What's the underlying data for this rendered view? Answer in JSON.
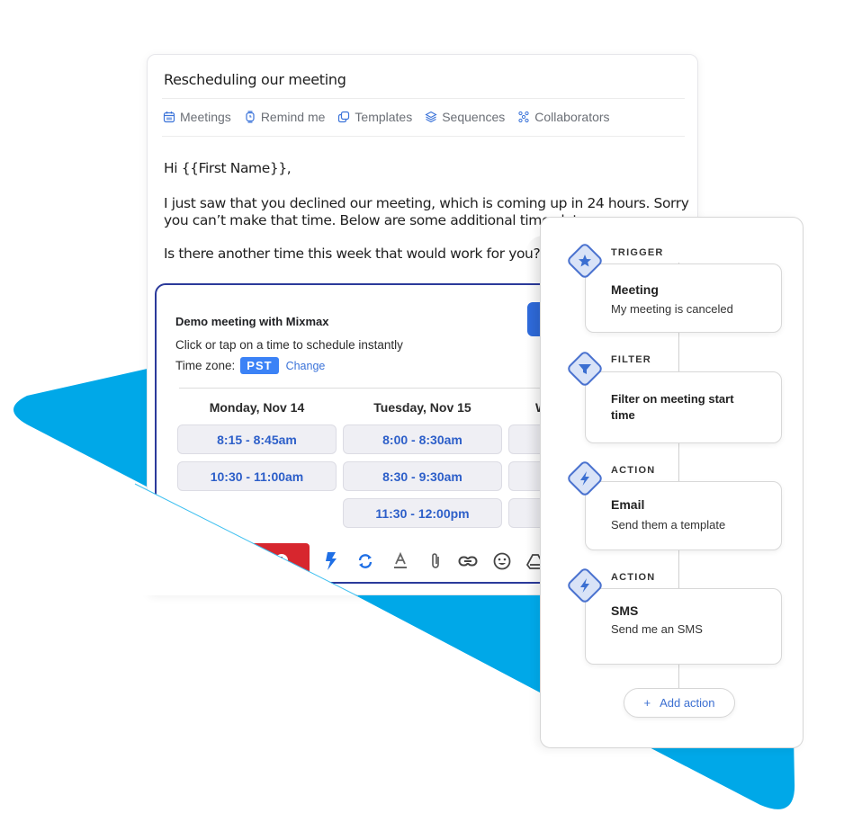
{
  "colors": {
    "brand_blue": "#00a8e8",
    "accent_blue": "#3b73d9",
    "meeting_border": "#2b3a9b",
    "send_red": "#d7262e",
    "diamond_fill": "#d9e3f7",
    "diamond_stroke": "#4a72cf"
  },
  "email": {
    "subject": "Rescheduling our meeting",
    "toolbar": [
      {
        "icon": "calendar-icon",
        "label": "Meetings"
      },
      {
        "icon": "watch-icon",
        "label": "Remind me"
      },
      {
        "icon": "templates-icon",
        "label": "Templates"
      },
      {
        "icon": "layers-icon",
        "label": "Sequences"
      },
      {
        "icon": "collaborators-icon",
        "label": "Collaborators"
      }
    ],
    "greeting": "Hi {{First Name}},",
    "paragraph_line1": "I just saw that you declined our meeting, which is coming up in 24 hours. Sorry",
    "paragraph_line2": "you can’t make that time. Below are some additional time slots",
    "question": "Is there another time this week that would work for you?"
  },
  "meeting": {
    "title": "Demo meeting with Mixmax",
    "instructions": "Click or tap on a time to schedule instantly",
    "timezone_label": "Time zone:",
    "timezone": "PST",
    "change_link": "Change",
    "days": [
      {
        "label": "Monday, Nov 14",
        "slots": [
          "8:15 - 8:45am",
          "10:30 - 11:00am"
        ]
      },
      {
        "label": "Tuesday, Nov 15",
        "slots": [
          "8:00 - 8:30am",
          "8:30 - 9:30am",
          "11:30 - 12:00pm"
        ]
      },
      {
        "label": "W",
        "slots": [
          "",
          "",
          ""
        ]
      }
    ]
  },
  "compose_toolbar": {
    "icons": [
      "send-later-icon",
      "lightning-icon",
      "sync-icon",
      "text-format-icon",
      "attachment-icon",
      "link-icon",
      "emoji-icon",
      "drive-icon"
    ]
  },
  "workflow": {
    "steps": [
      {
        "type": "TRIGGER",
        "icon": "star-icon",
        "title": "Meeting",
        "description": "My meeting is canceled"
      },
      {
        "type": "FILTER",
        "icon": "filter-icon",
        "title": "Filter on meeting start time",
        "description": ""
      },
      {
        "type": "ACTION",
        "icon": "lightning-icon",
        "title": "Email",
        "description": "Send them a template"
      },
      {
        "type": "ACTION",
        "icon": "lightning-icon",
        "title": "SMS",
        "description": "Send me an SMS"
      }
    ],
    "add_action_icon": "+",
    "add_action_label": "Add action"
  }
}
